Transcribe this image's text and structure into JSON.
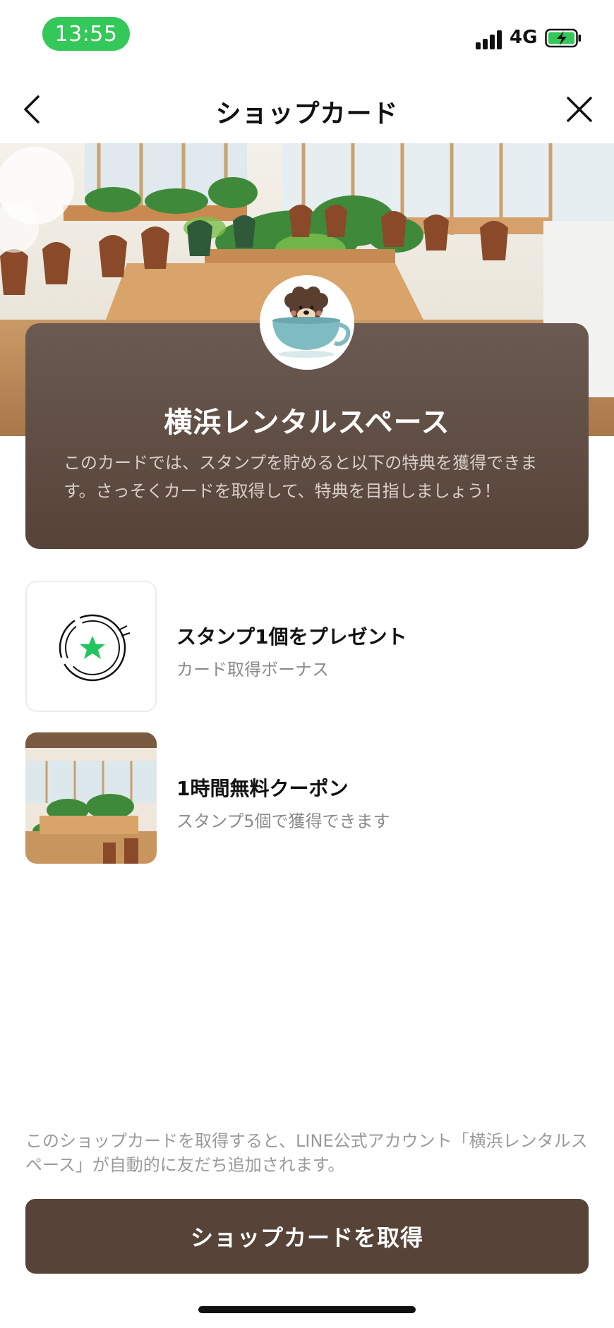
{
  "status_bar": {
    "time": "13:55",
    "network": "4G",
    "signal_icon": "signal-bars-icon",
    "battery_icon": "battery-charging-icon"
  },
  "header": {
    "title": "ショップカード",
    "back_icon": "chevron-left-icon",
    "close_icon": "close-icon"
  },
  "shop": {
    "name": "横浜レンタルスペース",
    "description": "このカードでは、スタンプを貯めると以下の特典を獲得できます。さっそくカードを取得して、特典を目指しましょう！",
    "avatar_icon": "dog-in-teacup-avatar"
  },
  "rewards": [
    {
      "title": "スタンプ1個をプレゼント",
      "subtitle": "カード取得ボーナス",
      "icon": "star-stamp-icon"
    },
    {
      "title": "1時間無料クーポン",
      "subtitle": "スタンプ5個で獲得できます",
      "icon": "rental-space-photo"
    }
  ],
  "footer": {
    "notice": "このショップカードを取得すると、LINE公式アカウント「横浜レンタルスペース」が自動的に友だち追加されます。",
    "button_label": "ショップカードを取得"
  },
  "colors": {
    "brand_brown": "#574338",
    "status_green": "#34c759",
    "stamp_green": "#22c55e"
  }
}
